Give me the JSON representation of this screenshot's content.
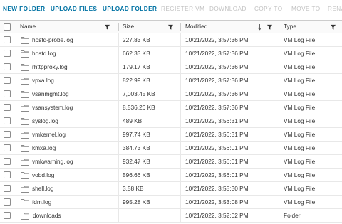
{
  "toolbar": {
    "buttons": [
      {
        "label": "NEW FOLDER",
        "enabled": true
      },
      {
        "label": "UPLOAD FILES",
        "enabled": true
      },
      {
        "label": "UPLOAD FOLDER",
        "enabled": true
      },
      {
        "label": "REGISTER VM",
        "enabled": false
      },
      {
        "label": "DOWNLOAD",
        "enabled": false
      },
      {
        "label": "COPY TO",
        "enabled": false
      },
      {
        "label": "MOVE TO",
        "enabled": false
      },
      {
        "label": "RENA",
        "enabled": false
      }
    ]
  },
  "table": {
    "columns": {
      "name": "Name",
      "size": "Size",
      "modified": "Modified",
      "type": "Type"
    },
    "rows": [
      {
        "name": "hostd-probe.log",
        "size": "227.83 KB",
        "modified": "10/21/2022, 3:57:36 PM",
        "type": "VM Log File",
        "kind": "file"
      },
      {
        "name": "hostd.log",
        "size": "662.33 KB",
        "modified": "10/21/2022, 3:57:36 PM",
        "type": "VM Log File",
        "kind": "file"
      },
      {
        "name": "rhttpproxy.log",
        "size": "179.17 KB",
        "modified": "10/21/2022, 3:57:36 PM",
        "type": "VM Log File",
        "kind": "file"
      },
      {
        "name": "vpxa.log",
        "size": "822.99 KB",
        "modified": "10/21/2022, 3:57:36 PM",
        "type": "VM Log File",
        "kind": "file"
      },
      {
        "name": "vsanmgmt.log",
        "size": "7,003.45 KB",
        "modified": "10/21/2022, 3:57:36 PM",
        "type": "VM Log File",
        "kind": "file"
      },
      {
        "name": "vsansystem.log",
        "size": "8,536.26 KB",
        "modified": "10/21/2022, 3:57:36 PM",
        "type": "VM Log File",
        "kind": "file"
      },
      {
        "name": "syslog.log",
        "size": "489 KB",
        "modified": "10/21/2022, 3:56:31 PM",
        "type": "VM Log File",
        "kind": "file"
      },
      {
        "name": "vmkernel.log",
        "size": "997.74 KB",
        "modified": "10/21/2022, 3:56:31 PM",
        "type": "VM Log File",
        "kind": "file"
      },
      {
        "name": "kmxa.log",
        "size": "384.73 KB",
        "modified": "10/21/2022, 3:56:01 PM",
        "type": "VM Log File",
        "kind": "file"
      },
      {
        "name": "vmkwarning.log",
        "size": "932.47 KB",
        "modified": "10/21/2022, 3:56:01 PM",
        "type": "VM Log File",
        "kind": "file"
      },
      {
        "name": "vobd.log",
        "size": "596.66 KB",
        "modified": "10/21/2022, 3:56:01 PM",
        "type": "VM Log File",
        "kind": "file"
      },
      {
        "name": "shell.log",
        "size": "3.58 KB",
        "modified": "10/21/2022, 3:55:30 PM",
        "type": "VM Log File",
        "kind": "file"
      },
      {
        "name": "fdm.log",
        "size": "995.28 KB",
        "modified": "10/21/2022, 3:53:08 PM",
        "type": "VM Log File",
        "kind": "file"
      },
      {
        "name": "downloads",
        "size": "",
        "modified": "10/21/2022, 3:52:02 PM",
        "type": "Folder",
        "kind": "folder"
      }
    ]
  },
  "colors": {
    "accent": "#0072a3",
    "disabled": "#c3c3c3"
  }
}
